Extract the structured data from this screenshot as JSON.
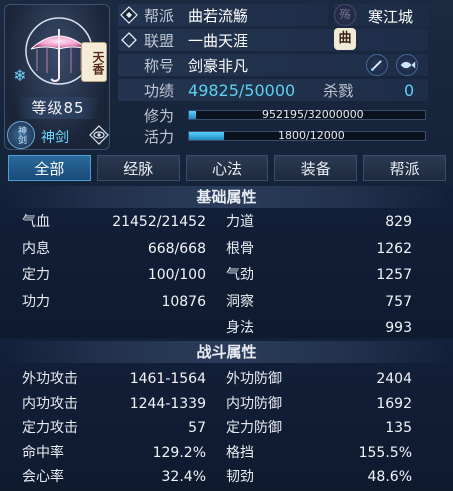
{
  "portrait": {
    "faction_tag": "天香",
    "level_text": "等级85",
    "school_badge": "神剑",
    "school_name": "神剑"
  },
  "info": {
    "sect_label": "帮派",
    "sect_value": "曲若流觞",
    "sect_badge": "殇",
    "city": "寒江城",
    "alliance_label": "联盟",
    "alliance_value": "一曲天涯",
    "alliance_badge": "曲",
    "title_label": "称号",
    "title_value": "剑豪非凡",
    "merit_label": "功绩",
    "merit_value": "49825/50000",
    "kills_label": "杀戮",
    "kills_value": "0",
    "cultivation_label": "修为",
    "cultivation_value": "952195/32000000",
    "cultivation_fraction": 0.0298,
    "vitality_label": "活力",
    "vitality_value": "1800/12000",
    "vitality_fraction": 0.15
  },
  "tabs": [
    "全部",
    "经脉",
    "心法",
    "装备",
    "帮派"
  ],
  "active_tab": 0,
  "basic": {
    "title": "基础属性",
    "left": [
      {
        "k": "气血",
        "v": "21452/21452"
      },
      {
        "k": "内息",
        "v": "668/668"
      },
      {
        "k": "定力",
        "v": "100/100"
      },
      {
        "k": "功力",
        "v": "10876"
      }
    ],
    "right": [
      {
        "k": "力道",
        "v": "829"
      },
      {
        "k": "根骨",
        "v": "1262"
      },
      {
        "k": "气劲",
        "v": "1257"
      },
      {
        "k": "洞察",
        "v": "757"
      },
      {
        "k": "身法",
        "v": "993"
      }
    ]
  },
  "combat": {
    "title": "战斗属性",
    "left": [
      {
        "k": "外功攻击",
        "v": "1461-1564"
      },
      {
        "k": "内功攻击",
        "v": "1244-1339"
      },
      {
        "k": "定力攻击",
        "v": "57"
      },
      {
        "k": "命中率",
        "v": "129.2%"
      },
      {
        "k": "会心率",
        "v": "32.4%"
      }
    ],
    "right": [
      {
        "k": "外功防御",
        "v": "2404"
      },
      {
        "k": "内功防御",
        "v": "1692"
      },
      {
        "k": "定力防御",
        "v": "135"
      },
      {
        "k": "格挡",
        "v": "155.5%"
      },
      {
        "k": "韧劲",
        "v": "48.6%"
      }
    ]
  },
  "colors": {
    "accent": "#5cd0ee",
    "tab_active": "#1a4a78",
    "bar_fill": "#3ab4ea"
  }
}
